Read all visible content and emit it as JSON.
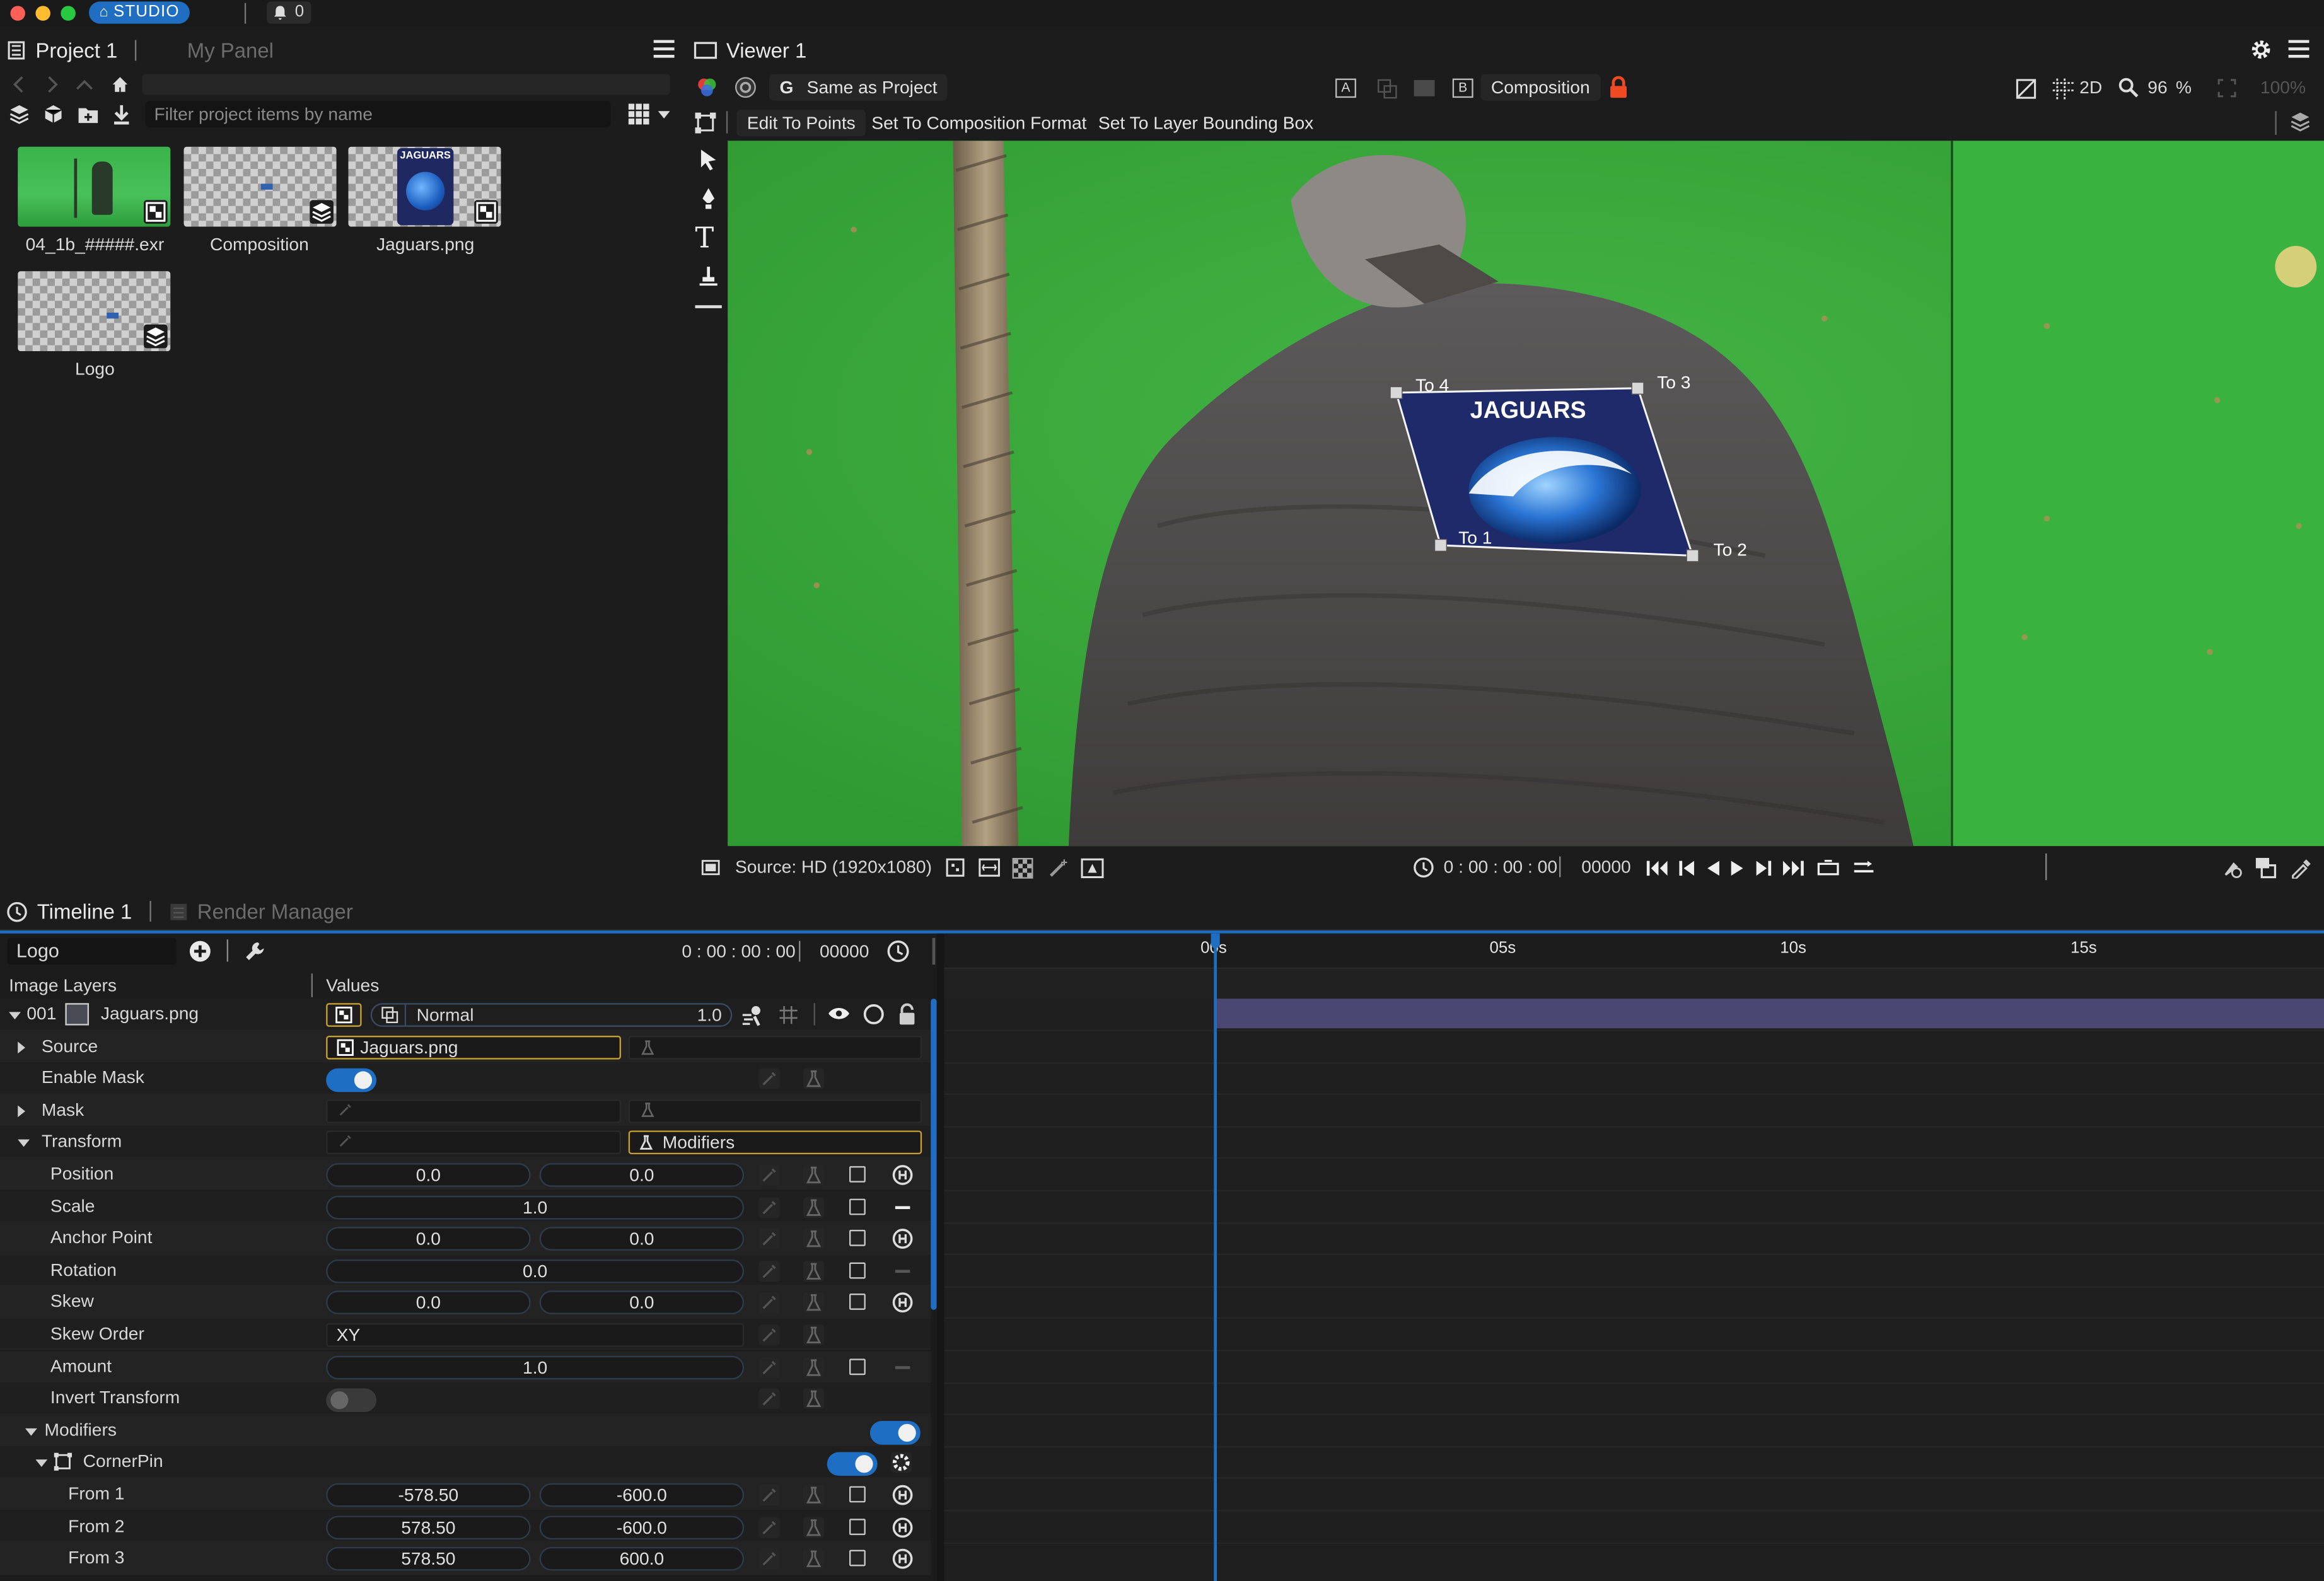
{
  "top_bar": {
    "app_badge": "STUDIO",
    "notification_count": "0",
    "traffic_colors": [
      "#fe5f57",
      "#febc2e",
      "#28c840"
    ]
  },
  "project_panel": {
    "tab_active": "Project 1",
    "tab_inactive": "My Panel",
    "filter_placeholder": "Filter project items by name",
    "items": [
      {
        "label": "04_1b_#####.exr",
        "kind": "image-sequence"
      },
      {
        "label": "Composition",
        "kind": "composition"
      },
      {
        "label": "Jaguars.png",
        "kind": "image"
      },
      {
        "label": "Logo",
        "kind": "composition"
      }
    ]
  },
  "viewer_panel": {
    "title": "Viewer 1",
    "color_space": "Same as Project",
    "channel_a": "A",
    "channel_b": "B",
    "compare_target": "Composition",
    "view_mode": "2D",
    "zoom": "96",
    "zoom_unit": "%",
    "zoom_fit": "100%",
    "actions": [
      "Edit To Points",
      "Set To Composition Format",
      "Set To Layer Bounding Box"
    ],
    "corner_labels": {
      "to1": "To 1",
      "to2": "To 2",
      "to3": "To 3",
      "to4": "To 4"
    },
    "logo_text": "JAGUARS",
    "source_label": "Source: HD (1920x1080)",
    "timecode": "0 : 00 : 00 : 00",
    "frame": "00000",
    "accent": "#1f6ec2"
  },
  "timeline_panel": {
    "tab_active": "Timeline 1",
    "tab_inactive": "Render Manager",
    "comp_name": "Logo",
    "timecode": "0 : 00 : 00 : 00",
    "frame": "00000",
    "col_layers": "Image Layers",
    "col_values": "Values",
    "ruler": [
      "00s",
      "05s",
      "10s",
      "15s"
    ],
    "layer": {
      "index": "001",
      "name": "Jaguars.png",
      "blend": "Normal",
      "opacity": "1.0"
    },
    "source_value": "Jaguars.png",
    "modifiers_button": "Modifiers",
    "rows": [
      {
        "label": "Source"
      },
      {
        "label": "Enable Mask"
      },
      {
        "label": "Mask"
      },
      {
        "label": "Transform"
      },
      {
        "label": "Position",
        "v1": "0.0",
        "v2": "0.0"
      },
      {
        "label": "Scale",
        "v1": "1.0"
      },
      {
        "label": "Anchor Point",
        "v1": "0.0",
        "v2": "0.0"
      },
      {
        "label": "Rotation",
        "v1": "0.0"
      },
      {
        "label": "Skew",
        "v1": "0.0",
        "v2": "0.0"
      },
      {
        "label": "Skew Order",
        "v1": "XY"
      },
      {
        "label": "Amount",
        "v1": "1.0"
      },
      {
        "label": "Invert Transform"
      },
      {
        "label": "Modifiers"
      },
      {
        "label": "CornerPin"
      },
      {
        "label": "From 1",
        "v1": "-578.50",
        "v2": "-600.0"
      },
      {
        "label": "From 2",
        "v1": "578.50",
        "v2": "-600.0"
      },
      {
        "label": "From 3",
        "v1": "578.50",
        "v2": "600.0"
      }
    ]
  }
}
